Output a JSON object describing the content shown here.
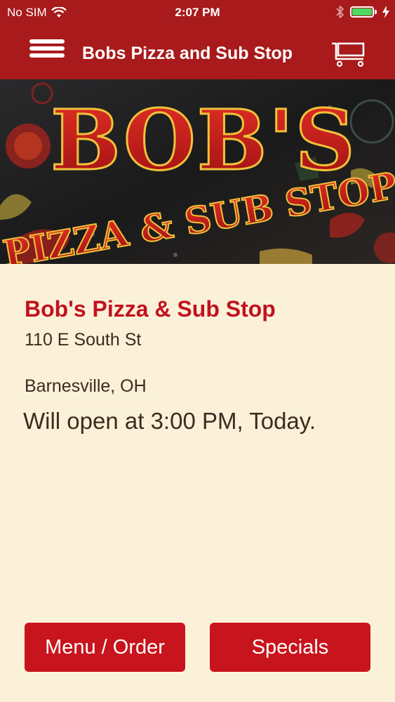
{
  "status_bar": {
    "carrier": "No SIM",
    "time": "2:07 PM",
    "battery_color": "#4cd964"
  },
  "nav": {
    "title": "Bobs Pizza and Sub Stop",
    "menu_icon": "hamburger-menu-icon",
    "cart_icon": "shopping-cart-icon"
  },
  "hero": {
    "logo_line1": "BOB'S",
    "logo_line2": "PIZZA & SUB STOP"
  },
  "restaurant": {
    "name": "Bob's Pizza & Sub Stop",
    "address": "110 E South St",
    "city": "Barnesville, OH",
    "open_status": "Will open at 3:00 PM, Today."
  },
  "buttons": {
    "menu_order": "Menu / Order",
    "specials": "Specials"
  },
  "colors": {
    "header_bg": "#a81a1b",
    "accent_red": "#c1121f",
    "button_red": "#c8141c",
    "background": "#fbf1d8",
    "text_dark": "#3d2b20"
  }
}
